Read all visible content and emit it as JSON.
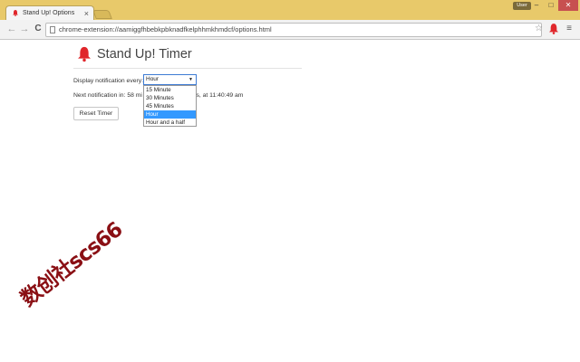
{
  "browser": {
    "tab_title": "Stand Up! Options",
    "tab_close": "×",
    "user_label": "User",
    "address": "chrome-extension://aamiggfhbebkpbknadfkelphhmkhmdcf/options.html",
    "window_controls": {
      "minimize": "–",
      "maximize": "□",
      "close": "✕"
    },
    "back_glyph": "←",
    "forward_glyph": "→",
    "reload_glyph": "C",
    "star_glyph": "☆",
    "menu_glyph": "≡"
  },
  "page": {
    "title": "Stand Up! Timer",
    "frequency_label": "Display notification every:",
    "frequency_selected": "Hour",
    "frequency_options": [
      "15 Minute",
      "30 Minutes",
      "45 Minutes",
      "Hour",
      "Hour and a half"
    ],
    "next_notification_prefix": "Next notification in: 58 mi",
    "next_notification_suffix": "ls, at 11:40:49 am",
    "reset_button": "Reset Timer",
    "accent_color": "#e0262b",
    "selection_color": "#3399ff"
  },
  "watermark": {
    "text": "数创社scs66",
    "color": "#8a0f14"
  }
}
